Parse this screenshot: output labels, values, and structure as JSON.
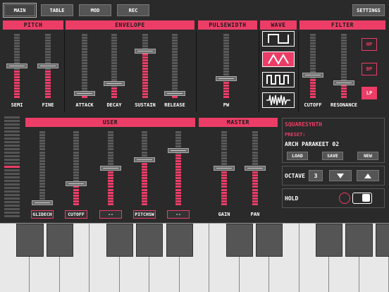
{
  "top_tabs": [
    {
      "label": "MAIN",
      "active": true
    },
    {
      "label": "TABLE",
      "active": false
    },
    {
      "label": "MOD",
      "active": false
    },
    {
      "label": "REC",
      "active": false
    }
  ],
  "settings_label": "SETTINGS",
  "sections": {
    "pitch": "PITCH",
    "envelope": "ENVELOPE",
    "pulsewidth": "PULSEWIDTH",
    "wave": "WAVE",
    "filter": "FILTER",
    "user": "USER",
    "master": "MASTER"
  },
  "sliders_top": [
    {
      "label": "SEMI",
      "value": 0.5
    },
    {
      "label": "FINE",
      "value": 0.5
    },
    {
      "label": "ATTACK",
      "value": 0.04
    },
    {
      "label": "DECAY",
      "value": 0.2
    },
    {
      "label": "SUSTAIN",
      "value": 0.75
    },
    {
      "label": "RELEASE",
      "value": 0.04
    },
    {
      "label": "PW",
      "value": 0.28
    },
    {
      "label": "CUTOFF",
      "value": 0.34
    },
    {
      "label": "RESONANCE",
      "value": 0.22
    }
  ],
  "wave_options": [
    "square",
    "triangle",
    "pulse",
    "noise"
  ],
  "wave_selected": 1,
  "filter_types": [
    {
      "label": "HP",
      "selected": false
    },
    {
      "label": "BP",
      "selected": false
    },
    {
      "label": "LP",
      "selected": true
    }
  ],
  "sliders_user": [
    {
      "label": "GLIDECH",
      "value": 0.0
    },
    {
      "label": "CUTOFF",
      "value": 0.28
    },
    {
      "label": "--",
      "value": 0.5
    },
    {
      "label": "PITCHSW",
      "value": 0.62
    },
    {
      "label": "--",
      "value": 0.76
    }
  ],
  "sliders_master": [
    {
      "label": "GAIN",
      "value": 0.5
    },
    {
      "label": "PAN",
      "value": 0.5
    }
  ],
  "pitch_wheel_level": 0.5,
  "preset_panel": {
    "title": "SQUARESYNTH",
    "preset_label": "PRESET:",
    "preset_name": "ARCH PARAKEET 02",
    "load": "LOAD",
    "save": "SAVE",
    "new": "NEW"
  },
  "octave": {
    "label": "OCTAVE",
    "value": "3"
  },
  "hold": {
    "label": "HOLD",
    "on": false
  },
  "colors": {
    "accent": "#ec3d67",
    "background": "#2a2a2a",
    "panel": "#555555"
  }
}
